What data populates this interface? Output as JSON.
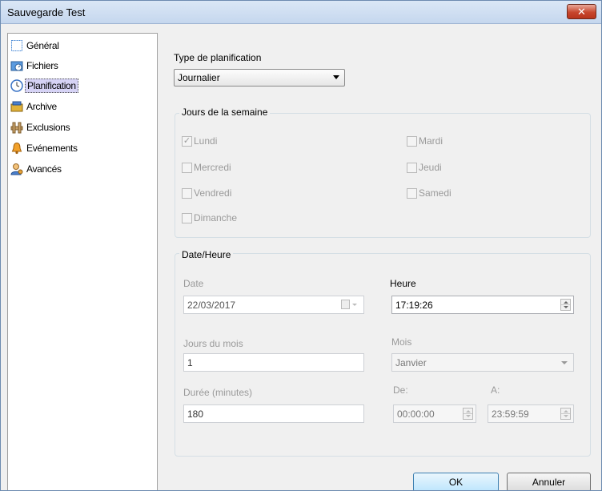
{
  "window": {
    "title": "Sauvegarde Test",
    "close_glyph": "✕"
  },
  "sidebar": {
    "items": [
      {
        "label": "Général",
        "icon": "general-icon",
        "selected": false
      },
      {
        "label": "Fichiers",
        "icon": "files-icon",
        "selected": false
      },
      {
        "label": "Planification",
        "icon": "clock-icon",
        "selected": true
      },
      {
        "label": "Archive",
        "icon": "archive-icon",
        "selected": false
      },
      {
        "label": "Exclusions",
        "icon": "exclusions-icon",
        "selected": false
      },
      {
        "label": "Evénements",
        "icon": "bell-icon",
        "selected": false
      },
      {
        "label": "Avancés",
        "icon": "user-gear-icon",
        "selected": false
      }
    ]
  },
  "schedule": {
    "type_label": "Type de planification",
    "type_value": "Journalier"
  },
  "weekdays": {
    "title": "Jours de la semaine",
    "days": [
      {
        "label": "Lundi",
        "checked": true
      },
      {
        "label": "Mardi",
        "checked": false
      },
      {
        "label": "Mercredi",
        "checked": false
      },
      {
        "label": "Jeudi",
        "checked": false
      },
      {
        "label": "Vendredi",
        "checked": false
      },
      {
        "label": "Samedi",
        "checked": false
      },
      {
        "label": "Dimanche",
        "checked": false
      }
    ]
  },
  "datetime": {
    "title": "Date/Heure",
    "date_label": "Date",
    "date_value": "22/03/2017",
    "time_label": "Heure",
    "time_value": "17:19:26",
    "days_label": "Jours du mois",
    "days_value": "1",
    "month_label": "Mois",
    "month_value": "Janvier",
    "duration_label": "Durée (minutes)",
    "duration_value": "180",
    "from_label": "De:",
    "from_value": "00:00:00",
    "to_label": "A:",
    "to_value": "23:59:59"
  },
  "buttons": {
    "ok": "OK",
    "cancel": "Annuler"
  },
  "colors": {
    "selection": "#d6d3f5",
    "close_button": "#c7462c"
  }
}
